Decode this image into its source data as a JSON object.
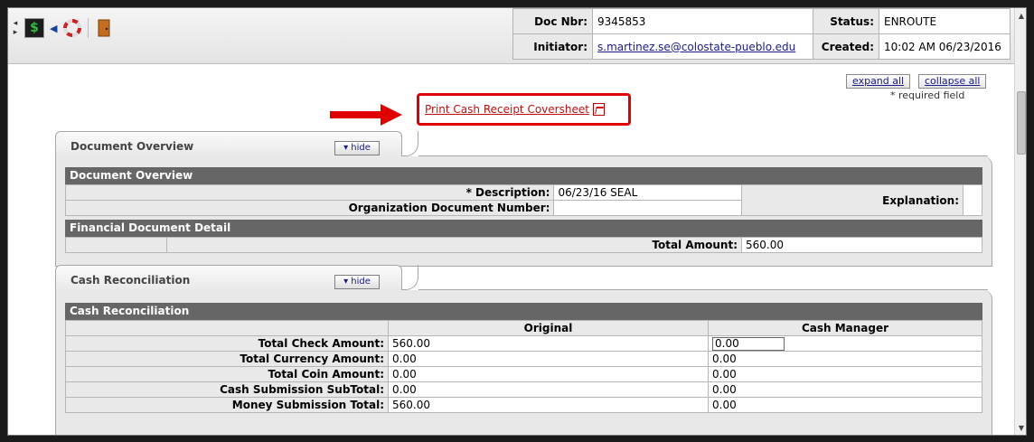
{
  "header": {
    "doc_nbr_label": "Doc Nbr:",
    "doc_nbr": "9345853",
    "status_label": "Status:",
    "status": "ENROUTE",
    "initiator_label": "Initiator:",
    "initiator": "s.martinez.se@colostate-pueblo.edu",
    "created_label": "Created:",
    "created": "10:02 AM 06/23/2016"
  },
  "toolbar": {
    "icons": [
      "arrows-icon",
      "dollar-icon",
      "back-arrow-icon",
      "help-lifebuoy-icon",
      "exit-door-icon"
    ]
  },
  "actions": {
    "expand_all": "expand all",
    "collapse_all": "collapse all",
    "required_field": "* required field",
    "print_coversheet": "Print Cash Receipt Coversheet"
  },
  "document_overview": {
    "tab_title": "Document Overview",
    "hide_label": "▾ hide",
    "section_title": "Document Overview",
    "description_label": "* Description:",
    "description": "06/23/16 SEAL",
    "explanation_label": "Explanation:",
    "org_doc_number_label": "Organization Document Number:",
    "org_doc_number": "",
    "financial_detail_title": "Financial Document Detail",
    "total_amount_label": "Total Amount:",
    "total_amount": "560.00"
  },
  "cash_reconciliation": {
    "tab_title": "Cash Reconciliation",
    "hide_label": "▾ hide",
    "section_title": "Cash Reconciliation",
    "col_original": "Original",
    "col_cash_manager": "Cash Manager",
    "rows": [
      {
        "label": "Total Check Amount:",
        "original": "560.00",
        "cash_manager": "0.00"
      },
      {
        "label": "Total Currency Amount:",
        "original": "0.00",
        "cash_manager": "0.00"
      },
      {
        "label": "Total Coin Amount:",
        "original": "0.00",
        "cash_manager": "0.00"
      },
      {
        "label": "Cash Submission SubTotal:",
        "original": "0.00",
        "cash_manager": "0.00"
      },
      {
        "label": "Money Submission Total:",
        "original": "560.00",
        "cash_manager": "0.00"
      }
    ]
  },
  "colors": {
    "section_header": "#666666",
    "label_bg": "#e9e9e9",
    "highlight_red": "#e00000",
    "link": "#1a1a8a"
  }
}
